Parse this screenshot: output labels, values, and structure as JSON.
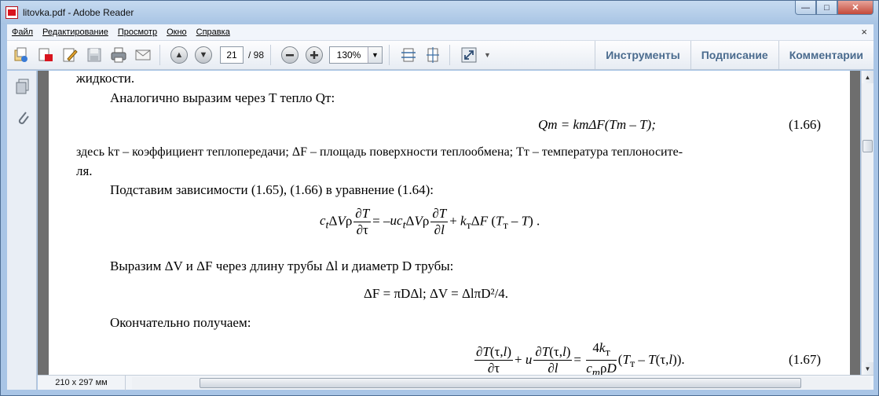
{
  "window": {
    "title": "litovka.pdf - Adobe Reader",
    "minimize": "—",
    "maximize": "□",
    "close": "✕"
  },
  "menu": {
    "items": [
      "Файл",
      "Редактирование",
      "Просмотр",
      "Окно",
      "Справка"
    ],
    "close_glyph": "×"
  },
  "toolbar": {
    "page_current": "21",
    "page_total": "/ 98",
    "zoom": "130%",
    "zoom_dropdown": "▼",
    "more": "▼",
    "tools": "Инструменты",
    "sign": "Подписание",
    "comment": "Комментарии"
  },
  "status": {
    "page_size": "210 x 297 мм"
  },
  "document": {
    "l1": "жидкости.",
    "l2": "Аналогично выразим через T тепло Qт:",
    "eq166": "Qт = kтΔF(Tт – T);",
    "eq166_num": "(1.66)",
    "l3": "здесь kт – коэффициент теплопередачи; ΔF – площадь поверхности теплообмена; Tт – температура теплоносите-",
    "l4": "ля.",
    "l5": "Подставим зависимости (1.65), (1.66) в уравнение (1.64):",
    "l6": "Выразим ΔV и ΔF через длину трубы Δl и диаметр D трубы:",
    "eq_df": "ΔF = πDΔl;   ΔV = ΔlπD²/4.",
    "l7": "Окончательно получаем:",
    "eq167_num": "(1.67)"
  }
}
